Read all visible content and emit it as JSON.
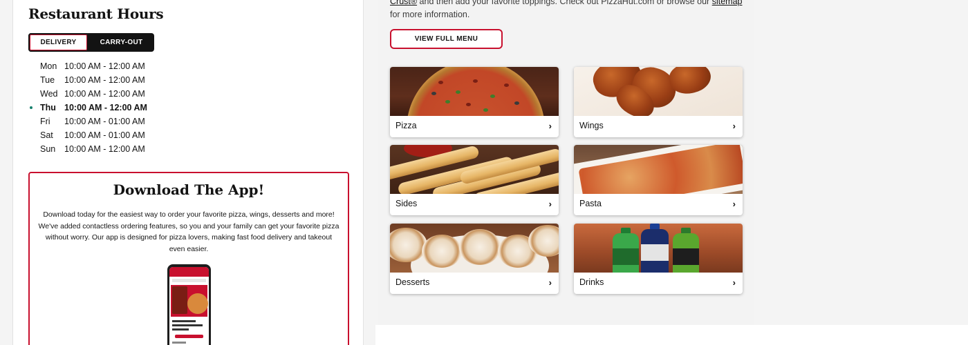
{
  "hours": {
    "title": "Restaurant Hours",
    "tabs": [
      "DELIVERY",
      "CARRY-OUT"
    ],
    "rows": [
      {
        "day": "Mon",
        "time": "10:00 AM - 12:00 AM"
      },
      {
        "day": "Tue",
        "time": "10:00 AM - 12:00 AM"
      },
      {
        "day": "Wed",
        "time": "10:00 AM - 12:00 AM"
      },
      {
        "day": "Thu",
        "time": "10:00 AM - 12:00 AM"
      },
      {
        "day": "Fri",
        "time": "10:00 AM - 01:00 AM"
      },
      {
        "day": "Sat",
        "time": "10:00 AM - 01:00 AM"
      },
      {
        "day": "Sun",
        "time": "10:00 AM - 12:00 AM"
      }
    ]
  },
  "app": {
    "title": "Download The App!",
    "description": "Download today for the easiest way to order your favorite pizza, wings, desserts and more! We've added contactless ordering features, so you and your family can get your favorite pizza without worry. Our app is designed for pizza lovers, making fast food delivery and takeout even easier."
  },
  "info": {
    "link1": "Crust®",
    "text1": " and then add your favorite toppings. Check out PizzaHut.com or browse our ",
    "link2": "sitemap",
    "text2": " for more information."
  },
  "menu_button": "VIEW FULL MENU",
  "categories": [
    {
      "label": "Pizza",
      "icon": "chevron-right-icon"
    },
    {
      "label": "Wings",
      "icon": "chevron-right-icon"
    },
    {
      "label": "Sides",
      "icon": "chevron-right-icon"
    },
    {
      "label": "Pasta",
      "icon": "chevron-right-icon"
    },
    {
      "label": "Desserts",
      "icon": "chevron-right-icon"
    },
    {
      "label": "Drinks",
      "icon": "chevron-right-icon"
    }
  ],
  "colors": {
    "brand_red": "#c8102e",
    "dark": "#131313",
    "current_day_dot": "#17806d"
  }
}
